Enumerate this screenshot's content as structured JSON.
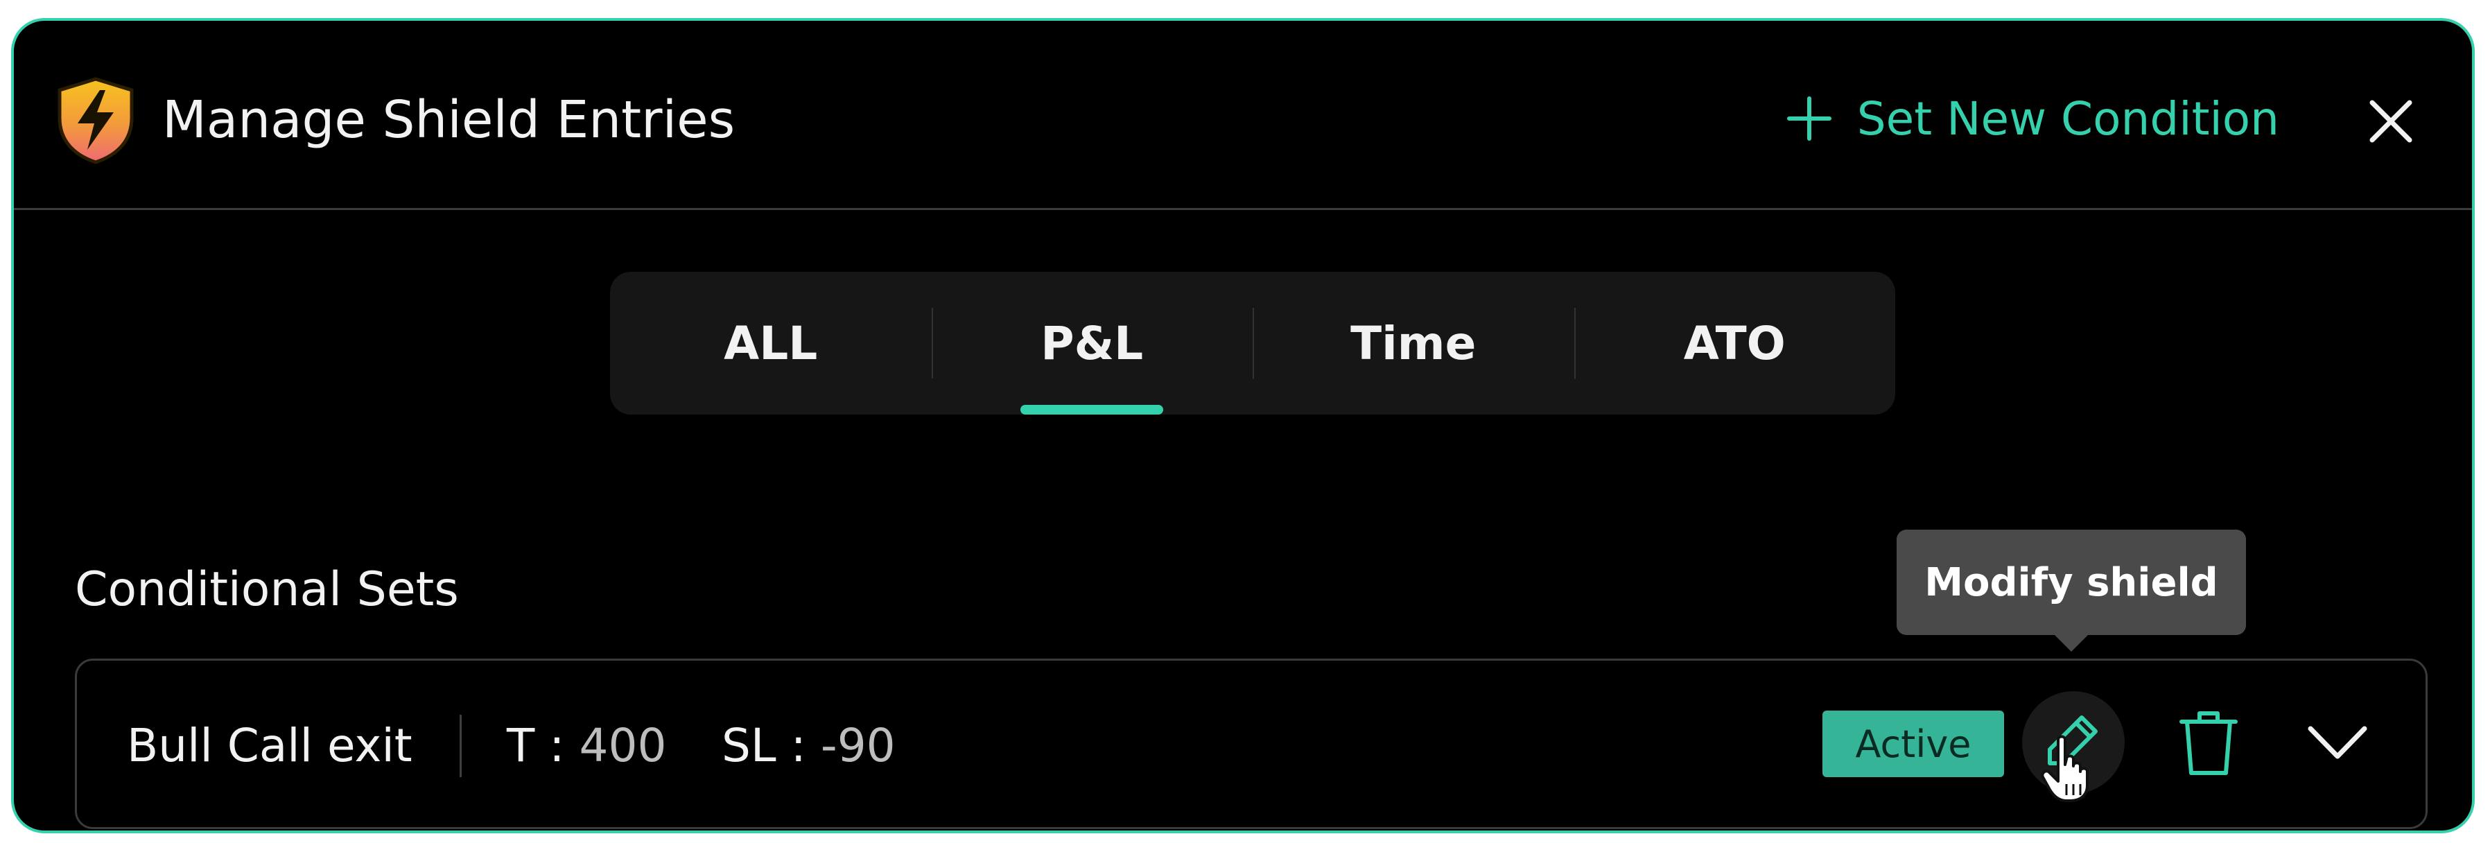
{
  "header": {
    "title": "Manage Shield Entries",
    "new_condition_label": "Set New Condition",
    "icons": {
      "logo": "shield-lightning-icon",
      "add": "plus-icon",
      "close": "close-icon"
    }
  },
  "tabs": [
    {
      "label": "ALL",
      "active": false
    },
    {
      "label": "P&L",
      "active": true
    },
    {
      "label": "Time",
      "active": false
    },
    {
      "label": "ATO",
      "active": false
    }
  ],
  "section": {
    "title": "Conditional Sets"
  },
  "tooltip": {
    "text": "Modify shield"
  },
  "condition_row": {
    "name": "Bull Call exit",
    "target_label": "T :",
    "target_value": "400",
    "stoploss_label": "SL :",
    "stoploss_value": "-90",
    "status": "Active",
    "icons": {
      "edit": "pencil-icon",
      "cursor": "hand-pointer-icon",
      "delete": "trash-icon",
      "expand": "chevron-down-icon"
    }
  },
  "colors": {
    "accent": "#35d1ad",
    "badge": "#35b497",
    "background": "#000000",
    "tooltip": "#4a4a4a",
    "shield_top": "#f5b823",
    "shield_bottom": "#ee6a72"
  }
}
